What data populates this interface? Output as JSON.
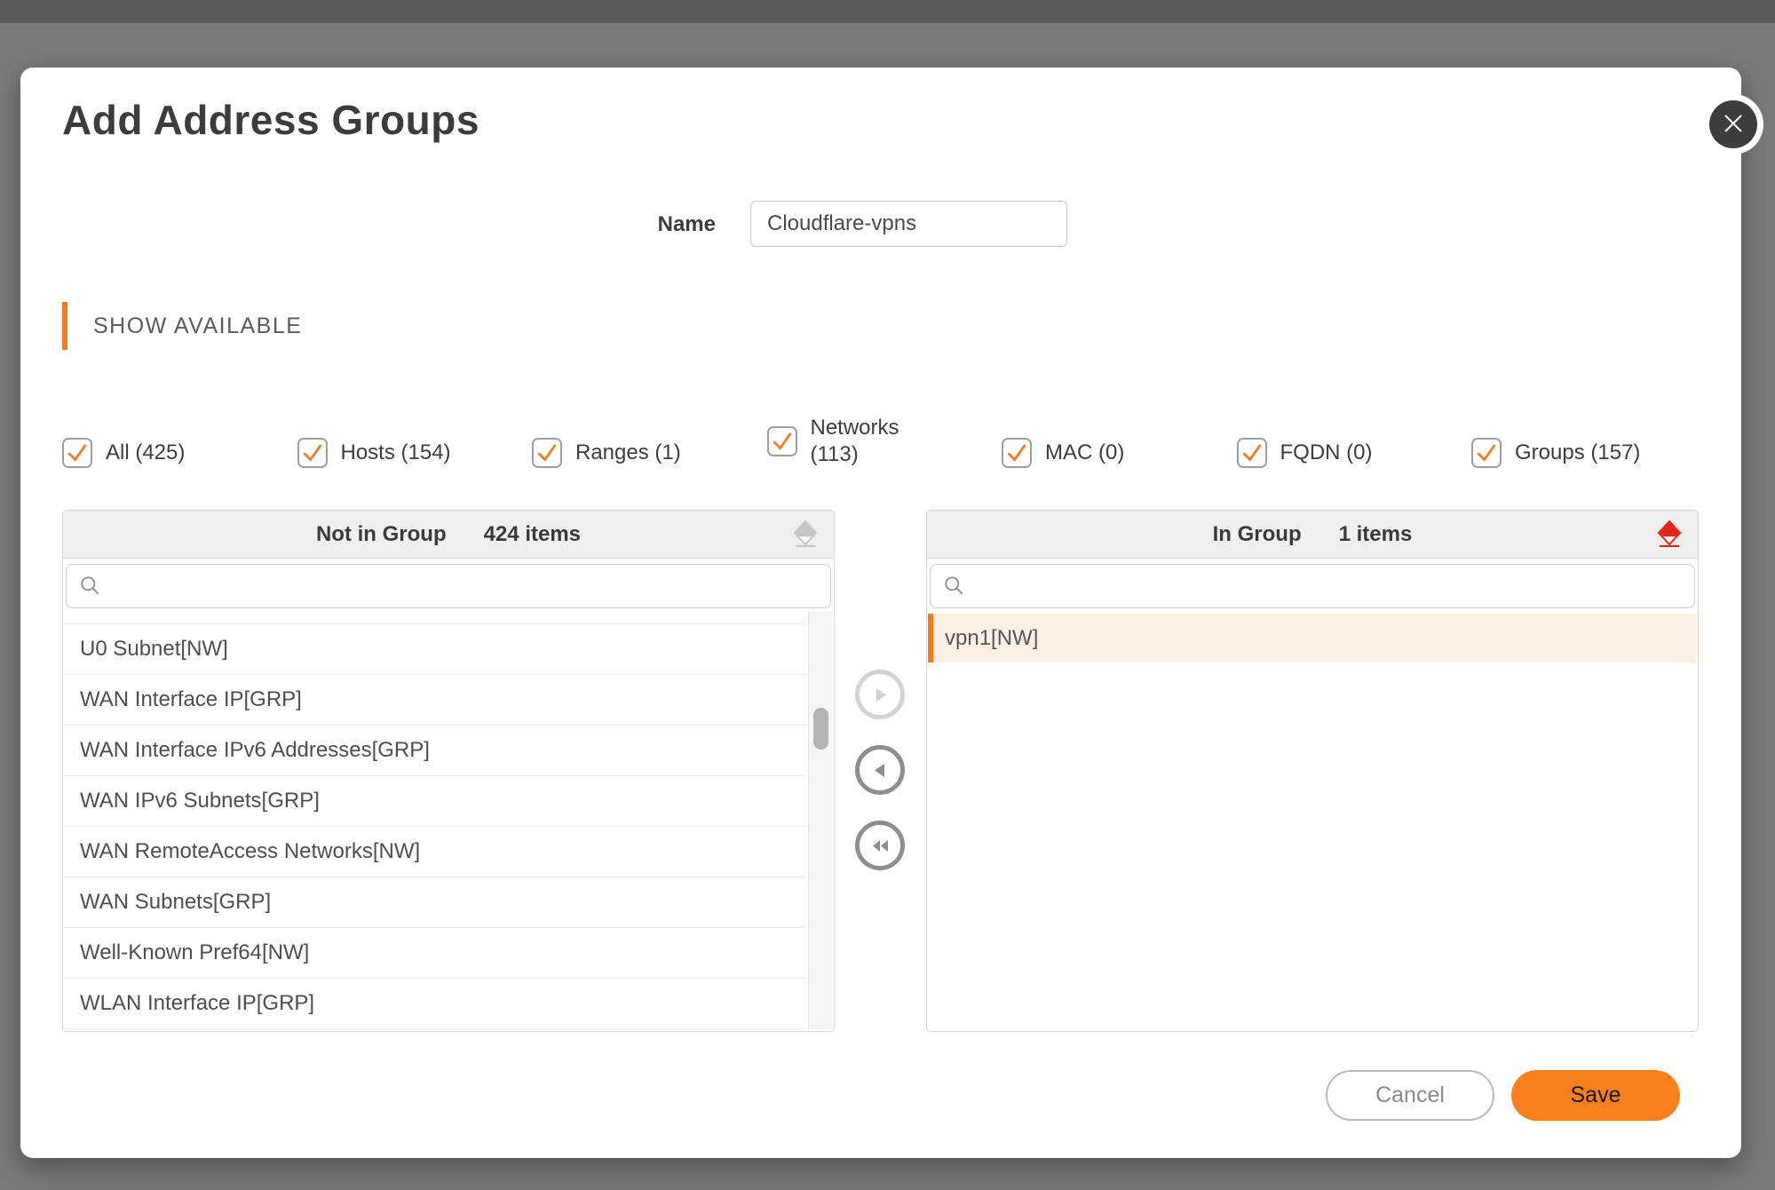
{
  "dialog": {
    "title": "Add Address Groups"
  },
  "name_field": {
    "label": "Name",
    "value": "Cloudflare-vpns",
    "placeholder": ""
  },
  "section_header": "SHOW AVAILABLE",
  "filters": [
    {
      "label": "All (425)",
      "checked": true
    },
    {
      "label": "Hosts (154)",
      "checked": true
    },
    {
      "label": "Ranges (1)",
      "checked": true
    },
    {
      "label": "Networks (113)",
      "checked": true,
      "wrap": true
    },
    {
      "label": "MAC (0)",
      "checked": true
    },
    {
      "label": "FQDN (0)",
      "checked": true
    },
    {
      "label": "Groups (157)",
      "checked": true
    }
  ],
  "not_in_group": {
    "title": "Not in Group",
    "count": "424 items",
    "search_placeholder": "",
    "eraser_state": "inactive",
    "items": [
      {
        "label": "U0 Subnet[NW]"
      },
      {
        "label": "WAN Interface IP[GRP]"
      },
      {
        "label": "WAN Interface IPv6 Addresses[GRP]"
      },
      {
        "label": "WAN IPv6 Subnets[GRP]"
      },
      {
        "label": "WAN RemoteAccess Networks[NW]"
      },
      {
        "label": "WAN Subnets[GRP]"
      },
      {
        "label": "Well-Known Pref64[NW]"
      },
      {
        "label": "WLAN Interface IP[GRP]"
      }
    ]
  },
  "in_group": {
    "title": "In Group",
    "count": "1 items",
    "search_placeholder": "",
    "eraser_state": "active",
    "items": [
      {
        "label": "vpn1[NW]",
        "selected": true
      }
    ]
  },
  "transfer_buttons": [
    {
      "icon": "arrow-right-icon",
      "disabled": true
    },
    {
      "icon": "arrow-left-icon",
      "disabled": false
    },
    {
      "icon": "double-arrow-left-icon",
      "disabled": false
    }
  ],
  "footer": {
    "cancel_label": "Cancel",
    "save_label": "Save"
  },
  "colors": {
    "accent_orange": "#F47B20",
    "save_orange": "#F9801D",
    "selected_row_bg": "#FCEFE3",
    "eraser_active_red": "#E3261D",
    "eraser_inactive_gray": "#C6C6C6",
    "backdrop_gray": "#7A7A7A"
  }
}
